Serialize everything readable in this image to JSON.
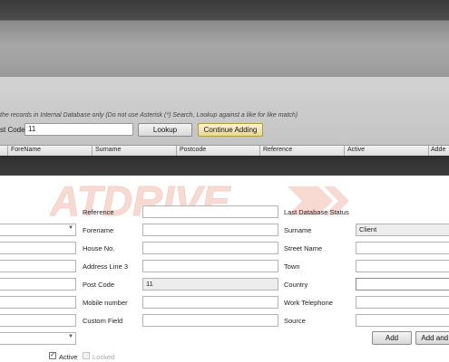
{
  "search": {
    "hint": "the records in Internal Database only  (Do not use Asterisk (*) Search, Lookup against a like for like match)",
    "postcode_label": "st Code",
    "postcode_value": "11",
    "lookup_label": "Lookup",
    "continue_label": "Continue Adding"
  },
  "grid": {
    "columns": [
      "ForeName",
      "Surname",
      "Postcode",
      "Reference",
      "Active",
      "Adde"
    ]
  },
  "watermark": {
    "text": "ATDRIVE"
  },
  "form": {
    "reference_label": "Reference",
    "forename_label": "Forename",
    "house_no_label": "House No.",
    "address3_label": "Address Line 3",
    "post_code_label": "Post Code",
    "post_code_value": "11",
    "mobile_label": "Mobile number",
    "custom_field_label": "Custom Field",
    "last_status_label": "Last Database Status",
    "surname_label": "Surname",
    "surname_value": "Client",
    "street_label": "Street Name",
    "town_label": "Town",
    "country_label": "Country",
    "work_tel_label": "Work Telephone",
    "source_label": "Source",
    "active_label": "Active",
    "locked_label": "Locked",
    "add_label": "Add",
    "add_and_label": "Add and S"
  },
  "colors": {
    "dark_bar": "#3a3a3a",
    "accent_button": "#e9d79a",
    "watermark": "#e05a3c"
  }
}
